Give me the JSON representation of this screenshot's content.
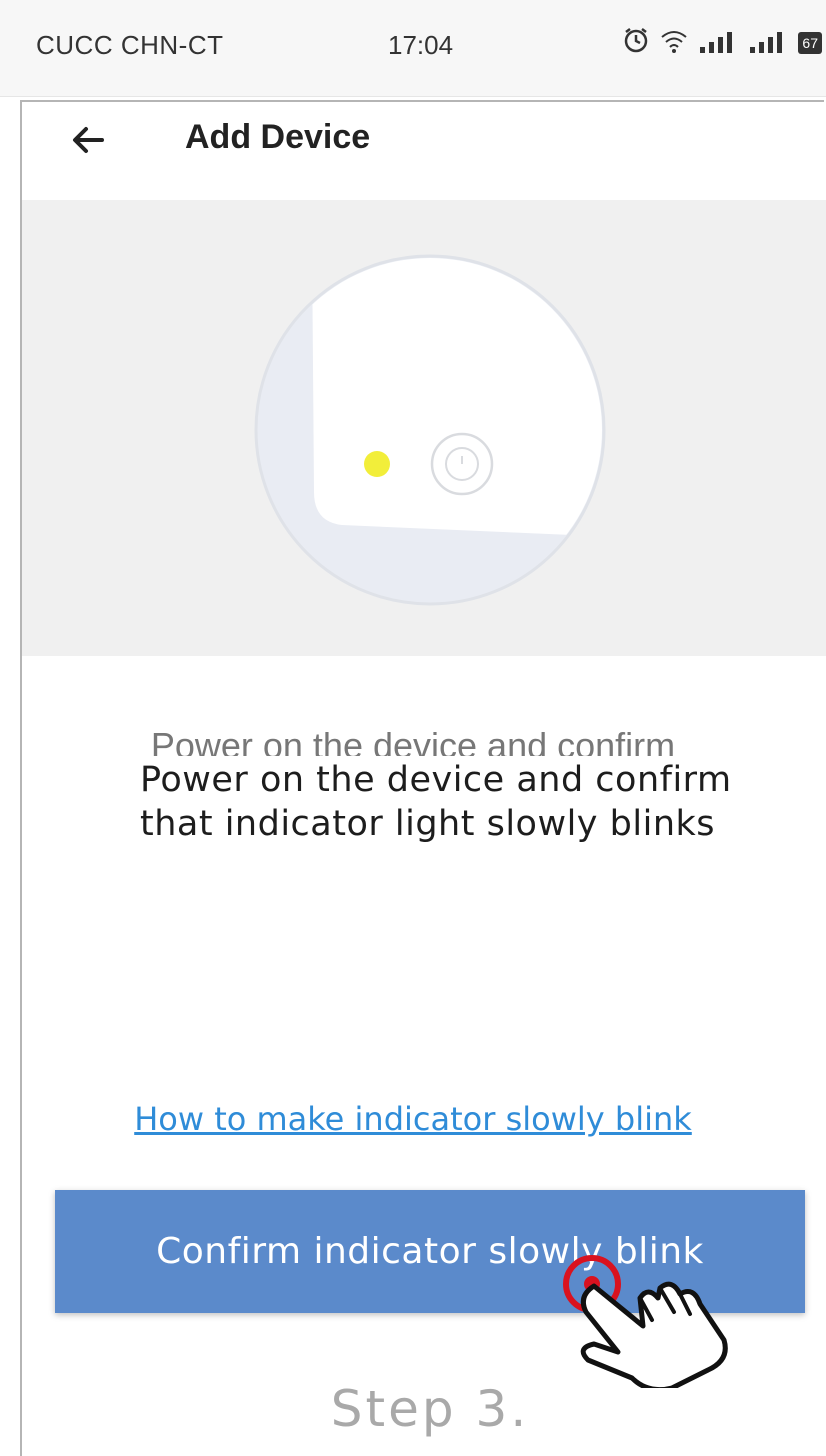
{
  "status_bar": {
    "carrier": "CUCC CHN-CT",
    "time": "17:04",
    "battery": "67"
  },
  "header": {
    "title": "Add Device",
    "back_icon": "arrow-left-icon"
  },
  "illustration": {
    "description_icon": "device-indicator-illustration",
    "indicator_color": "#f2ee3a"
  },
  "instructions": {
    "ghost_text": "Power on the device and confirm",
    "text": "Power on the device and confirm that indicator light slowly blinks"
  },
  "help_link": "How to make indicator slowly blink",
  "confirm_button": "Confirm indicator slowly blink",
  "annotation": {
    "step_label": "Step 3.",
    "pointer_icon": "hand-pointer-icon",
    "highlight_color": "#d9121f"
  },
  "colors": {
    "primary_button": "#5b8acb",
    "link": "#2f8cd8"
  }
}
